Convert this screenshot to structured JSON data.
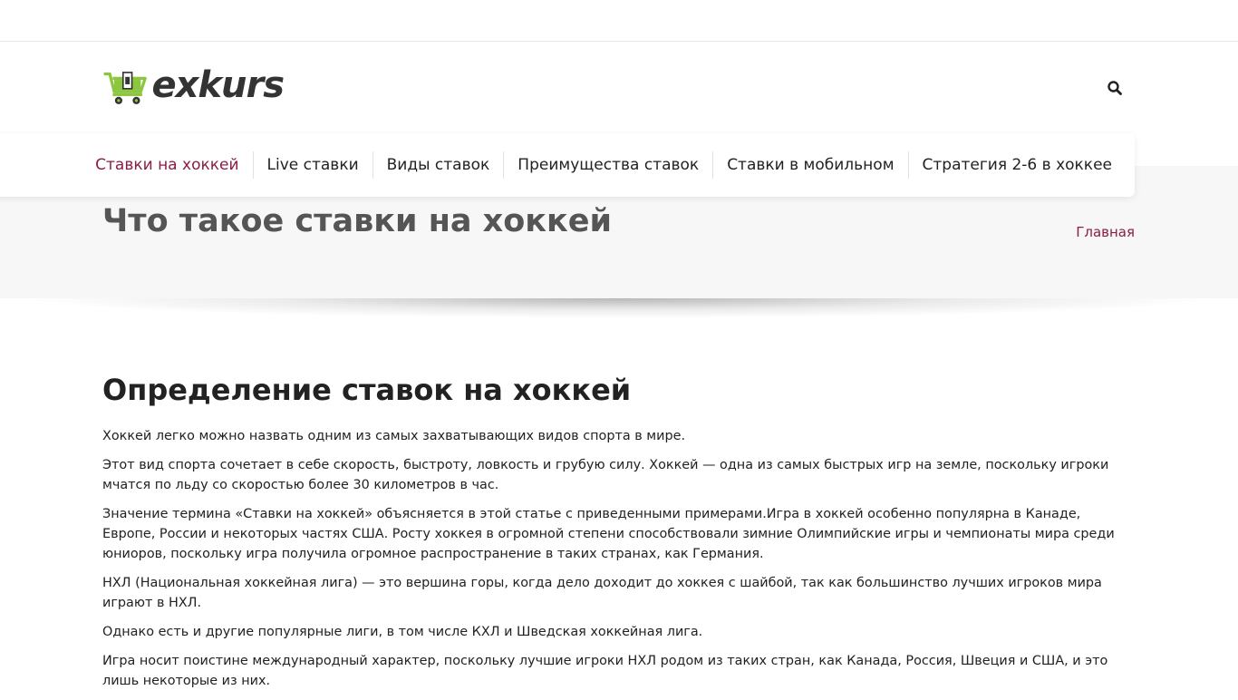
{
  "site": {
    "logo_text": "exkurs"
  },
  "colors": {
    "accent": "#8b1d47",
    "logo_green": "#8cc63f",
    "hero_bg": "#f7f7f7"
  },
  "nav": {
    "items": [
      {
        "label": "Ставки на хоккей",
        "active": true
      },
      {
        "label": "Live ставки"
      },
      {
        "label": "Виды ставок"
      },
      {
        "label": "Преимущества ставок"
      },
      {
        "label": "Ставки в мобильном"
      },
      {
        "label": "Стратегия 2-6 в хоккее"
      }
    ]
  },
  "header": {
    "search_icon": "search-icon"
  },
  "hero": {
    "title": "Что такое ставки на хоккей",
    "breadcrumb": "Главная"
  },
  "article": {
    "heading": "Определение ставок на хоккей",
    "paragraphs": [
      "Хоккей легко можно назвать одним из самых захватывающих видов спорта в мире.",
      "Этот вид спорта сочетает в себе скорость, быстроту, ловкость и грубую силу. Хоккей — одна из самых быстрых игр на земле, поскольку игроки мчатся по льду со скоростью более 30 километров в час.",
      "Значение термина «Ставки на хоккей» объясняется в этой статье с приведенными примерами.Игра в хоккей особенно популярна в Канаде, Европе, России и некоторых частях США. Росту хоккея в огромной степени способствовали зимние Олимпийские игры и чемпионаты мира среди юниоров, поскольку игра получила огромное распространение в таких странах, как Германия.",
      "НХЛ (Национальная хоккейная лига) — это вершина горы, когда дело доходит до хоккея с шайбой, так как большинство лучших игроков мира играют в НХЛ.",
      "Однако есть и другие популярные лиги, в том числе КХЛ и Шведская хоккейная лига.",
      "Игра носит поистине международный характер, поскольку лучшие игроки НХЛ родом из таких стран, как Канада, Россия, Швеция и США, и это лишь некоторые из них."
    ]
  }
}
